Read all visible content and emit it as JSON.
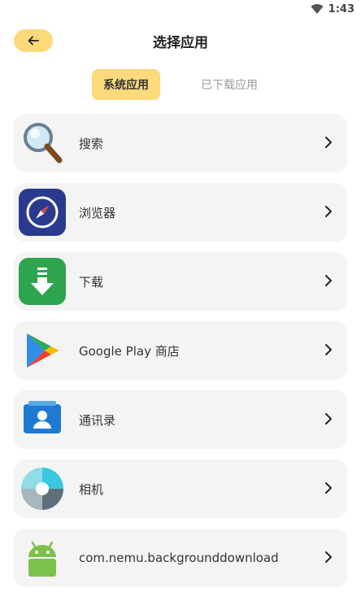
{
  "status": {
    "time": "1:43",
    "wifi_icon": "wifi-icon"
  },
  "header": {
    "title": "选择应用",
    "back_icon": "arrow-left-icon"
  },
  "tabs": [
    {
      "label": "系统应用",
      "active": true
    },
    {
      "label": "已下载应用",
      "active": false
    }
  ],
  "apps": [
    {
      "label": "搜索",
      "icon": "search-magnifier-icon"
    },
    {
      "label": "浏览器",
      "icon": "browser-compass-icon"
    },
    {
      "label": "下载",
      "icon": "download-icon"
    },
    {
      "label": "Google Play 商店",
      "icon": "google-play-icon"
    },
    {
      "label": "通讯录",
      "icon": "contacts-icon"
    },
    {
      "label": "相机",
      "icon": "camera-aperture-icon"
    },
    {
      "label": "com.nemu.backgrounddownload",
      "icon": "android-icon"
    }
  ],
  "colors": {
    "accent": "#fcd97a",
    "row_bg": "#f4f4f4"
  }
}
